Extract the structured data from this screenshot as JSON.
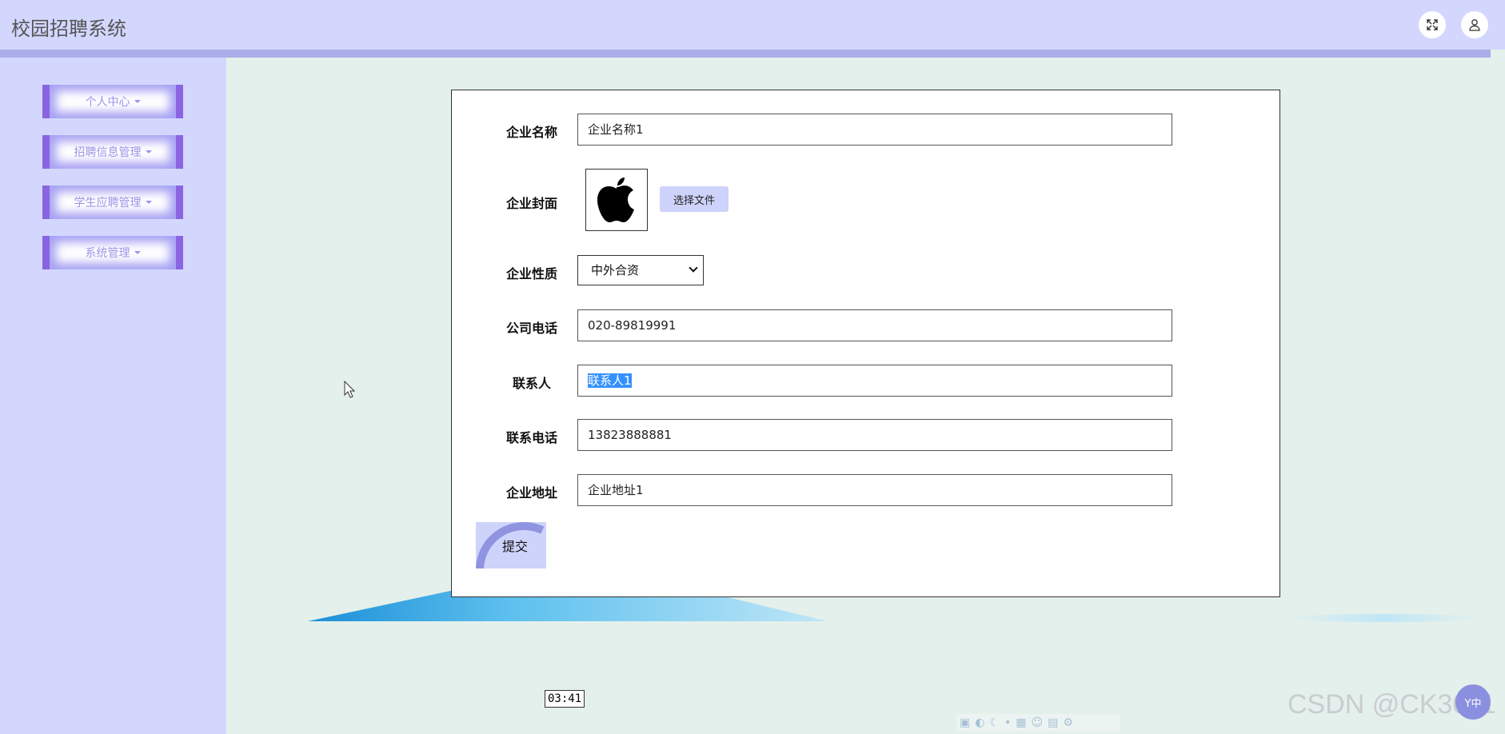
{
  "header": {
    "title": "校园招聘系统"
  },
  "sidebar": {
    "items": [
      {
        "label": "个人中心"
      },
      {
        "label": "招聘信息管理"
      },
      {
        "label": "学生应聘管理"
      },
      {
        "label": "系统管理"
      }
    ]
  },
  "form": {
    "fields": {
      "company_name": {
        "label": "企业名称",
        "value": "企业名称1"
      },
      "cover": {
        "label": "企业封面",
        "button": "选择文件"
      },
      "nature": {
        "label": "企业性质",
        "value": "中外合资"
      },
      "phone": {
        "label": "公司电话",
        "value": "020-89819991"
      },
      "contact": {
        "label": "联系人",
        "value": "联系人1"
      },
      "contact_phone": {
        "label": "联系电话",
        "value": "13823888881"
      },
      "address": {
        "label": "企业地址",
        "value": "企业地址1"
      }
    },
    "submit": "提交"
  },
  "overlay": {
    "timestamp": "03:41",
    "watermark": "CSDN @CK3011",
    "float_button": "Y中"
  },
  "icons": {
    "fullscreen": "expand-icon",
    "user": "user-icon",
    "cover_image": "apple-logo-icon"
  }
}
